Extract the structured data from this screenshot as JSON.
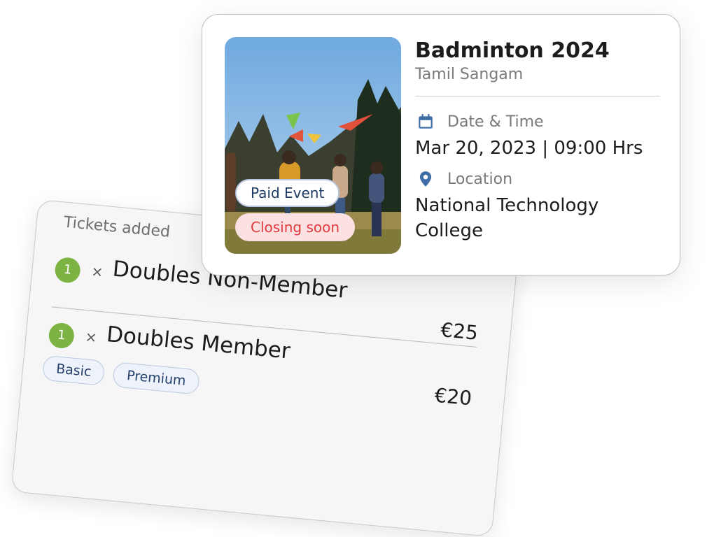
{
  "tickets": {
    "title": "Tickets added",
    "items": [
      {
        "qty": "1",
        "times": "×",
        "name": "Doubles Non-Member",
        "price": "€25"
      },
      {
        "qty": "1",
        "times": "×",
        "name": "Doubles Member",
        "price": "€20"
      }
    ],
    "tags": [
      "Basic",
      "Premium"
    ]
  },
  "event": {
    "title": "Badminton 2024",
    "organizer": "Tamil Sangam",
    "date_label": "Date & Time",
    "date_value": "Mar 20, 2023 | 09:00 Hrs",
    "location_label": "Location",
    "location_value": "National Technology College",
    "badges": {
      "paid": "Paid Event",
      "closing": "Closing soon"
    },
    "icons": {
      "date": "calendar-icon",
      "location": "location-pin-icon"
    }
  },
  "colors": {
    "qty_badge": "#7cb342",
    "accent_icon": "#3f6da6",
    "closing_text": "#e0393e",
    "closing_bg": "#fbe1e1",
    "paid_text": "#1d3b63"
  }
}
